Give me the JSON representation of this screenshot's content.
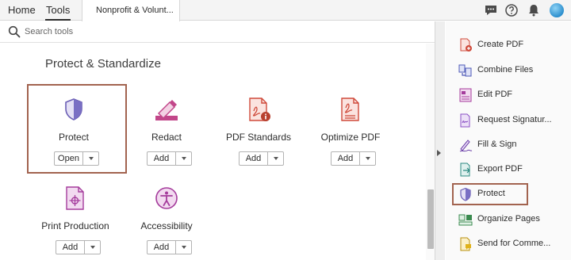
{
  "topbar": {
    "home_tab": "Home",
    "tools_tab": "Tools",
    "document_tab": "Nonprofit & Volunt...",
    "icons": [
      "comment-icon",
      "help-icon",
      "bell-icon",
      "avatar"
    ]
  },
  "search": {
    "placeholder": "Search tools"
  },
  "section": {
    "title": "Protect & Standardize"
  },
  "tools": [
    {
      "label": "Protect",
      "button": "Open",
      "icon": "shield-icon"
    },
    {
      "label": "Redact",
      "button": "Add",
      "icon": "redact-marker-icon"
    },
    {
      "label": "PDF Standards",
      "button": "Add",
      "icon": "pdf-standards-icon"
    },
    {
      "label": "Optimize PDF",
      "button": "Add",
      "icon": "optimize-pdf-icon"
    },
    {
      "label": "Print Production",
      "button": "Add",
      "icon": "print-production-icon"
    },
    {
      "label": "Accessibility",
      "button": "Add",
      "icon": "accessibility-icon"
    }
  ],
  "right_panel": {
    "items": [
      {
        "label": "Create PDF",
        "icon": "create-pdf-icon"
      },
      {
        "label": "Combine Files",
        "icon": "combine-files-icon"
      },
      {
        "label": "Edit PDF",
        "icon": "edit-pdf-icon"
      },
      {
        "label": "Request Signatur...",
        "icon": "request-signature-icon"
      },
      {
        "label": "Fill & Sign",
        "icon": "fill-sign-icon"
      },
      {
        "label": "Export PDF",
        "icon": "export-pdf-icon"
      },
      {
        "label": "Protect",
        "icon": "shield-icon"
      },
      {
        "label": "Organize Pages",
        "icon": "organize-pages-icon"
      },
      {
        "label": "Send for Comme...",
        "icon": "send-for-comment-icon"
      }
    ]
  },
  "colors": {
    "highlight_border": "#a2634f",
    "protect_purple": "#6b5fb5",
    "redact_pink": "#c2478a",
    "pdf_red": "#cf4a3b",
    "accent_blue": "#1473e6"
  }
}
